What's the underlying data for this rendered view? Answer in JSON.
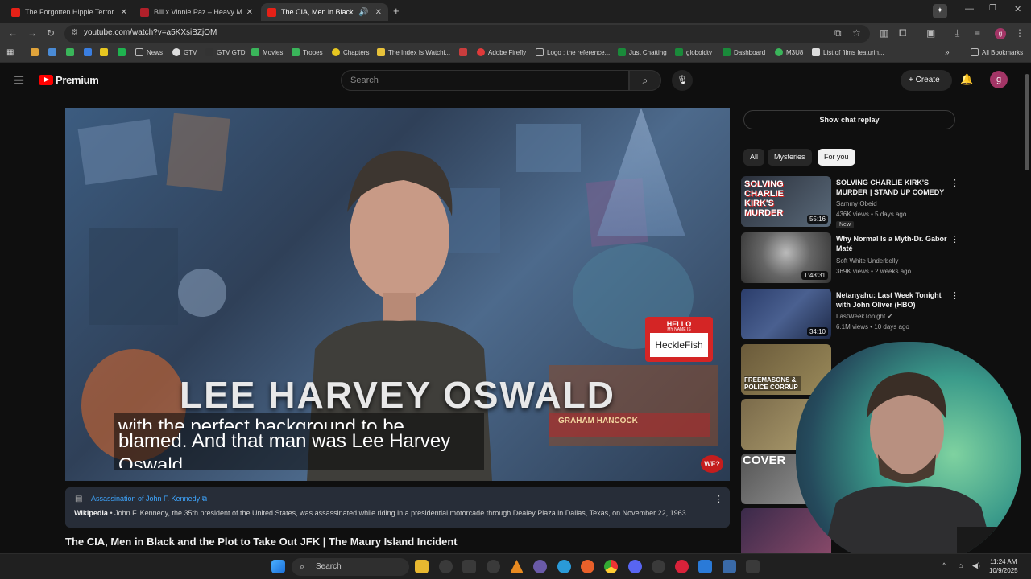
{
  "browser": {
    "tabs": [
      {
        "title": "The Forgotten Hippie Terror Cu",
        "active": false
      },
      {
        "title": "Bill x Vinnie Paz – Heavy Met",
        "active": false
      },
      {
        "title": "The CIA, Men in Black and t",
        "active": true
      }
    ],
    "new_tab": "+",
    "url": "youtube.com/watch?v=a5KXsiBZjOM",
    "bookmarks": [
      "News",
      "GTV",
      "GTV GTD",
      "Movies",
      "Tropes",
      "Chapters",
      "The Index Is Watchi...",
      "Adobe Firefly",
      "Logo : the reference...",
      "Just Chatting",
      "globoidtv",
      "Dashboard",
      "M3U8",
      "List of films featurin..."
    ],
    "all_bookmarks": "All Bookmarks"
  },
  "youtube": {
    "logo_text": "Premium",
    "search_placeholder": "Search",
    "create_label": "Create",
    "avatar_letter": "g"
  },
  "video": {
    "overlay_title": "LEE HARVEY OSWALD",
    "caption_line1": "with the perfect background to be",
    "caption_line2": "blamed. And that man was Lee Harvey",
    "caption_line3": "Oswald",
    "sign_header": "HELLO",
    "sign_sub": "MY NAME IS",
    "sign_name": "HeckleFish",
    "badge": "WF?",
    "book_label": "GRAHAM HANCOCK",
    "title": "The CIA, Men in Black and the Plot to Take Out JFK | The Maury Island Incident"
  },
  "info_card": {
    "title": "Assassination of John F. Kennedy",
    "source": "Wikipedia",
    "text": " • John F. Kennedy, the 35th president of the United States, was assassinated while riding in a presidential motorcade through Dealey Plaza in Dallas, Texas, on November 22, 1963."
  },
  "sidebar": {
    "chat_replay": "Show chat replay",
    "chips": [
      "All",
      "Mysteries",
      "For you"
    ],
    "selected_chip": "For you",
    "recs": [
      {
        "title": "SOLVING CHARLIE KIRK'S MURDER | STAND UP COMEDY",
        "channel": "Sammy Obeid",
        "meta": "436K views • 5 days ago",
        "badge": "New",
        "duration": "55:16",
        "thumb_text": "SOLVING CHARLIE KIRK'S MURDER"
      },
      {
        "title": "Why Normal Is a Myth-Dr. Gabor Maté",
        "channel": "Soft White Underbelly",
        "meta": "369K views • 2 weeks ago",
        "duration": "1:48:31"
      },
      {
        "title": "Netanyahu: Last Week Tonight with John Oliver (HBO)",
        "channel": "LastWeekTonight",
        "meta": "6.1M views • 10 days ago",
        "duration": "34:10"
      },
      {
        "thumb_text": "FREEMASONS & POLICE CORRUP"
      },
      {},
      {
        "thumb_text": "COVER"
      },
      {}
    ]
  },
  "taskbar": {
    "search": "Search",
    "time": "11:24 AM",
    "date": "10/9/2025"
  }
}
